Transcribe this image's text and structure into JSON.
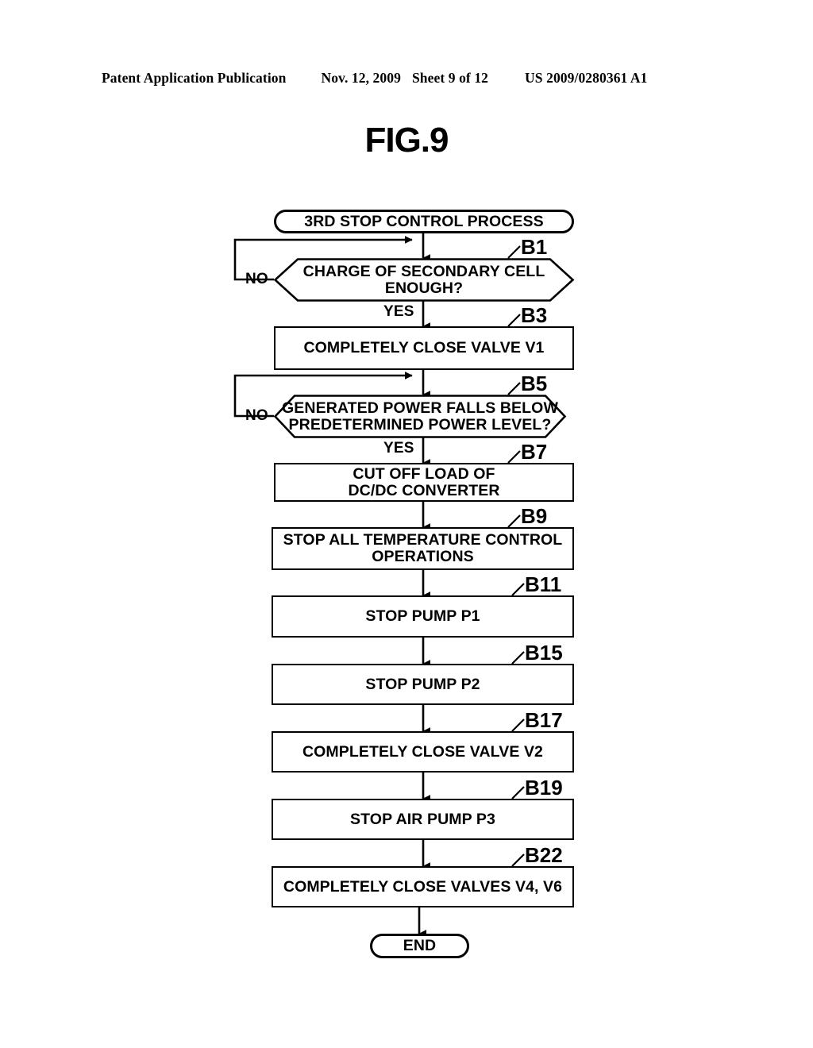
{
  "header": {
    "publication": "Patent Application Publication",
    "date": "Nov. 12, 2009",
    "sheet": "Sheet 9 of 12",
    "docnumber": "US 2009/0280361 A1"
  },
  "figure": {
    "title": "FIG.9"
  },
  "flowchart": {
    "type": "flowchart",
    "start": {
      "label": "3RD STOP CONTROL PROCESS",
      "shape": "terminator"
    },
    "end": {
      "label": "END",
      "shape": "terminator"
    },
    "nodes": [
      {
        "ref": "B1",
        "shape": "decision",
        "text": "CHARGE OF SECONDARY CELL ENOUGH?",
        "line1": "CHARGE OF SECONDARY CELL",
        "line2": "ENOUGH?",
        "yes": "YES",
        "no": "NO"
      },
      {
        "ref": "B3",
        "shape": "process",
        "text": "COMPLETELY CLOSE VALVE V1",
        "line1": "COMPLETELY CLOSE VALVE V1",
        "line2": ""
      },
      {
        "ref": "B5",
        "shape": "decision",
        "text": "GENERATED POWER FALLS BELOW PREDETERMINED POWER LEVEL?",
        "line1": "GENERATED POWER FALLS BELOW",
        "line2": "PREDETERMINED POWER LEVEL?",
        "yes": "YES",
        "no": "NO"
      },
      {
        "ref": "B7",
        "shape": "process",
        "text": "CUT OFF LOAD OF DC/DC CONVERTER",
        "line1": "CUT OFF LOAD OF",
        "line2": "DC/DC CONVERTER"
      },
      {
        "ref": "B9",
        "shape": "process",
        "text": "STOP ALL TEMPERATURE CONTROL OPERATIONS",
        "line1": "STOP ALL TEMPERATURE CONTROL",
        "line2": "OPERATIONS"
      },
      {
        "ref": "B11",
        "shape": "process",
        "text": "STOP PUMP P1",
        "line1": "STOP PUMP P1",
        "line2": ""
      },
      {
        "ref": "B15",
        "shape": "process",
        "text": "STOP PUMP P2",
        "line1": "STOP PUMP P2",
        "line2": ""
      },
      {
        "ref": "B17",
        "shape": "process",
        "text": "COMPLETELY CLOSE VALVE V2",
        "line1": "COMPLETELY CLOSE VALVE V2",
        "line2": ""
      },
      {
        "ref": "B19",
        "shape": "process",
        "text": "STOP AIR PUMP P3",
        "line1": "STOP AIR PUMP P3",
        "line2": ""
      },
      {
        "ref": "B22",
        "shape": "process",
        "text": "COMPLETELY CLOSE VALVES V4, V6",
        "line1": "COMPLETELY CLOSE VALVES V4, V6",
        "line2": ""
      }
    ]
  },
  "colors": {
    "ink": "#000000",
    "paper": "#ffffff"
  }
}
